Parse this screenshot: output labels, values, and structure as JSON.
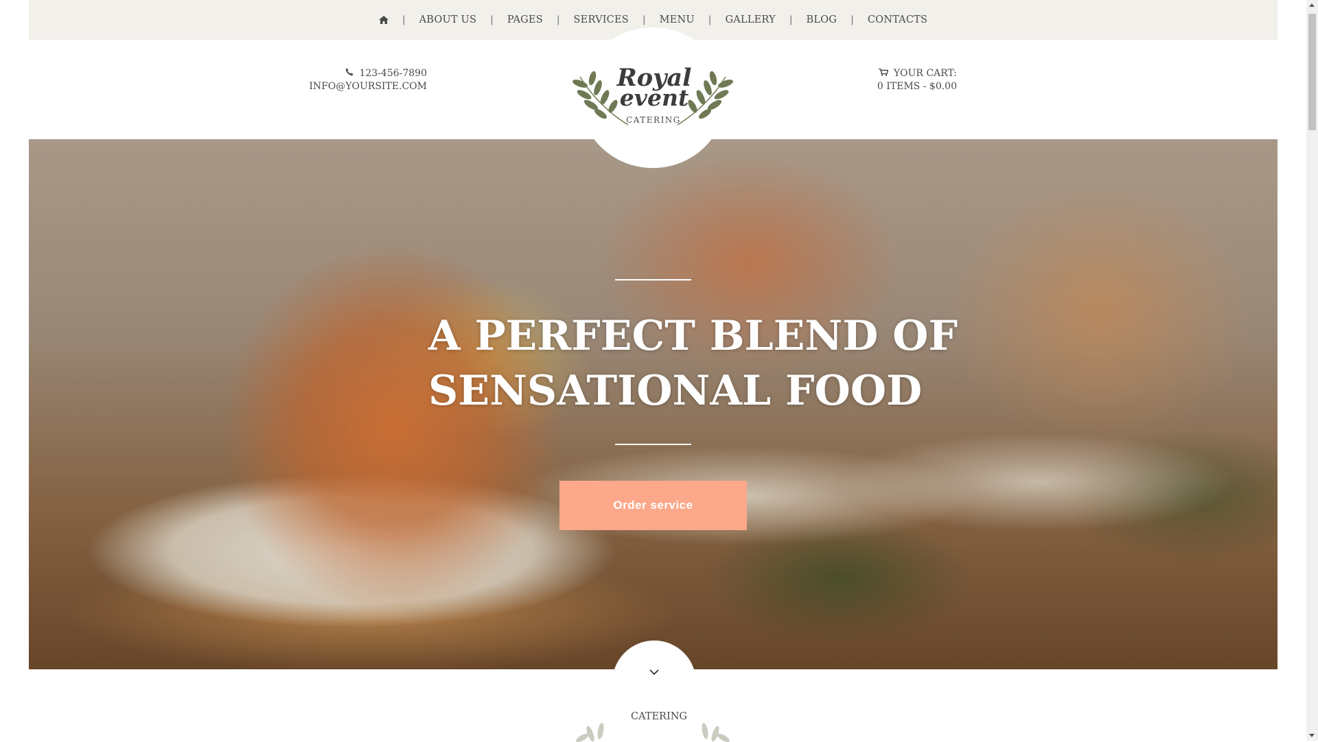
{
  "nav": {
    "home_icon": "home-icon",
    "separator": "|",
    "items": [
      {
        "label": "ABOUT US"
      },
      {
        "label": "PAGES"
      },
      {
        "label": "SERVICES"
      },
      {
        "label": "MENU"
      },
      {
        "label": "GALLERY"
      },
      {
        "label": "BLOG"
      },
      {
        "label": "CONTACTS"
      }
    ]
  },
  "header": {
    "phone_icon": "phone-icon",
    "phone": "123-456-7890",
    "email": "INFO@YOURSITE.COM",
    "cart_icon": "cart-icon",
    "cart_label": "YOUR CART:",
    "cart_summary": "0 ITEMS - $0.00"
  },
  "logo": {
    "line1": "Royal",
    "line2": "event",
    "tagline": "CATERING",
    "laurel_color": "#6f7a55"
  },
  "hero": {
    "title_line1": "A PERFECT BLEND OF",
    "title_line2": "SENSATIONAL FOOD",
    "button_label": "Order service",
    "button_color": "#fca88a"
  },
  "scroll_icon": "chevron-down-icon",
  "next_section": {
    "label": "CATERING"
  }
}
